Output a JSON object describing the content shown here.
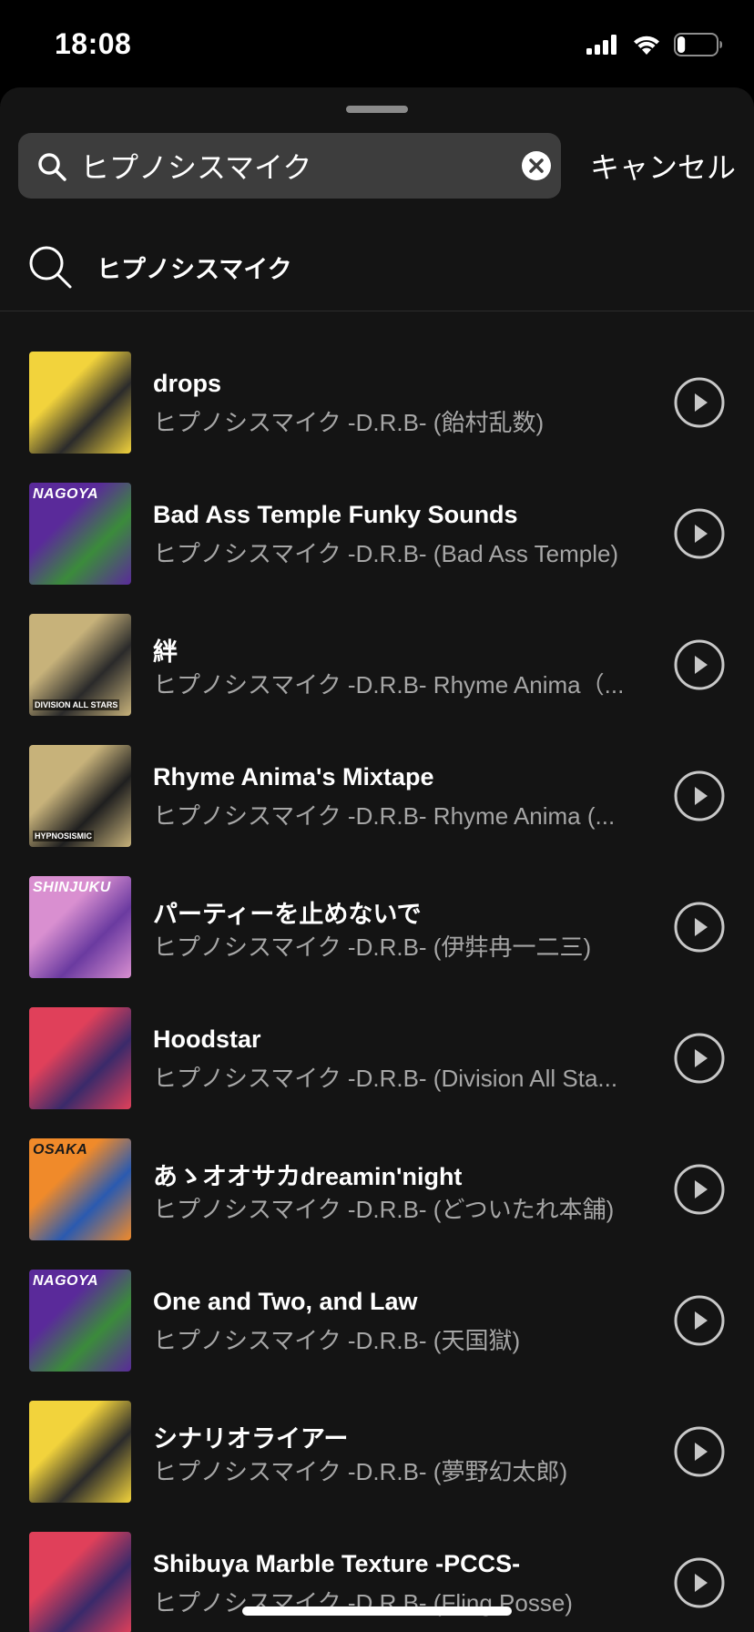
{
  "status_bar": {
    "time": "18:08",
    "icons": [
      "cellular-signal-icon",
      "wifi-icon",
      "battery-icon"
    ],
    "battery_level": 0.2
  },
  "search": {
    "query": "ヒプノシスマイク",
    "cancel_label": "キャンセル",
    "icons": {
      "search": "search-icon",
      "clear": "clear-icon"
    }
  },
  "suggestion": {
    "text": "ヒプノシスマイク",
    "icon": "search-icon"
  },
  "colors": {
    "background": "#141414",
    "search_field": "#3d3d3d",
    "secondary_text": "#a6a6a6",
    "play_icon": "#c8c8c8"
  },
  "results": [
    {
      "title": "drops",
      "artist": "ヒプノシスマイク -D.R.B- (飴村乱数)",
      "art_text": "",
      "art_colors": [
        "#f2d33c",
        "#2b2b2b"
      ]
    },
    {
      "title": "Bad Ass Temple Funky Sounds",
      "artist": "ヒプノシスマイク -D.R.B- (Bad Ass Temple)",
      "art_text": "NAGOYA",
      "art_colors": [
        "#5a2a9a",
        "#3b8b3b"
      ]
    },
    {
      "title": "絆",
      "artist": "ヒプノシスマイク -D.R.B- Rhyme Anima（...",
      "art_text": "DIVISION ALL STARS",
      "art_colors": [
        "#c7b27a",
        "#2a2a2a"
      ]
    },
    {
      "title": "Rhyme Anima's Mixtape",
      "artist": "ヒプノシスマイク -D.R.B- Rhyme Anima (...",
      "art_text": "HYPNOSISMIC",
      "art_colors": [
        "#c7b27a",
        "#1f1f1f"
      ]
    },
    {
      "title": "パーティーを止めないで",
      "artist": "ヒプノシスマイク -D.R.B- (伊弉冉一二三)",
      "art_text": "SHINJUKU",
      "art_colors": [
        "#d98fd0",
        "#6a3aa0"
      ]
    },
    {
      "title": "Hoodstar",
      "artist": "ヒプノシスマイク -D.R.B- (Division All Sta...",
      "art_text": "",
      "art_colors": [
        "#e0405a",
        "#3a2a6a"
      ]
    },
    {
      "title": "あゝオオサカdreamin'night",
      "artist": "ヒプノシスマイク -D.R.B- (どついたれ本舗)",
      "art_text": "OSAKA",
      "art_colors": [
        "#f08a2a",
        "#2a5ab0"
      ]
    },
    {
      "title": "One and Two, and Law",
      "artist": "ヒプノシスマイク -D.R.B- (天国獄)",
      "art_text": "NAGOYA",
      "art_colors": [
        "#5a2a9a",
        "#3b8b3b"
      ]
    },
    {
      "title": "シナリオライアー",
      "artist": "ヒプノシスマイク -D.R.B- (夢野幻太郎)",
      "art_text": "",
      "art_colors": [
        "#f2d33c",
        "#2b2b2b"
      ]
    },
    {
      "title": "Shibuya Marble Texture -PCCS-",
      "artist": "ヒプノシスマイク -D.R.B- (Fling Posse)",
      "art_text": "",
      "art_colors": [
        "#e0405a",
        "#3a2a6a"
      ]
    }
  ]
}
